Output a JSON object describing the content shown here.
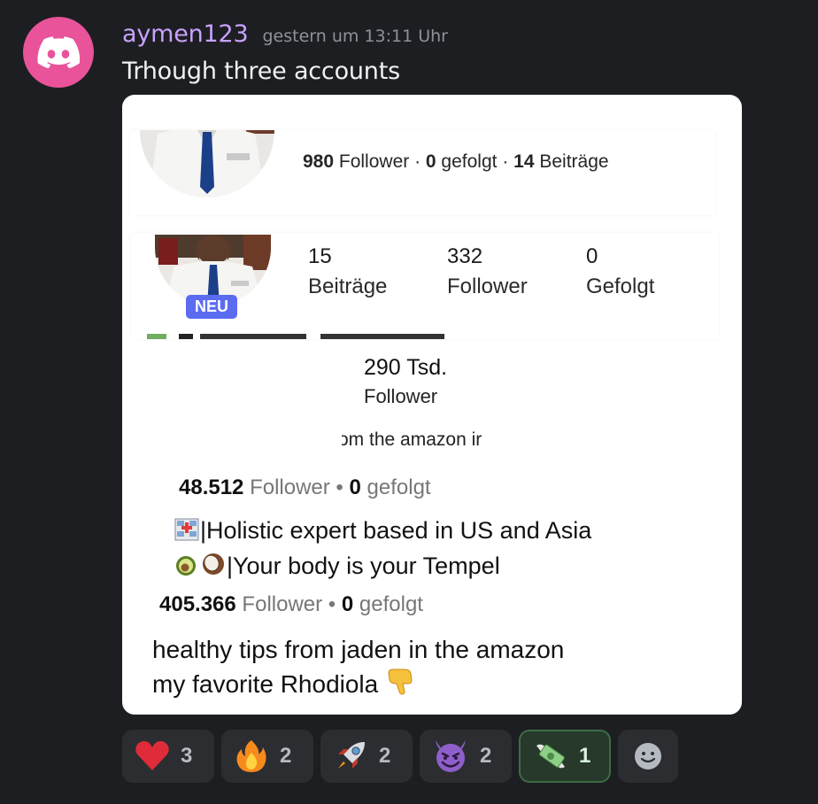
{
  "message": {
    "username": "aymen123",
    "timestamp": "gestern um 13:11 Uhr",
    "text": "Trhough three accounts",
    "avatar_icon": "discord-logo-icon"
  },
  "attachment": {
    "crop1": {
      "followers_num": "980",
      "followers_label": " Follower · ",
      "following_num": "0",
      "following_label": " gefolgt · ",
      "posts_num": "14",
      "posts_label": " Beiträge"
    },
    "crop2": {
      "badge": "NEU",
      "posts_num": "15",
      "posts_label": "Beiträge",
      "followers_num": "332",
      "followers_label": "Follower",
      "following_num": "0",
      "following_label": "Gefolgt"
    },
    "crop3": {
      "followers_num": "290 Tsd.",
      "followers_label": "Follower",
      "partial_text": "om the amazon ir"
    },
    "crop4": {
      "followers_num": "48.512",
      "followers_label": " Follower  •  ",
      "following_num": "0",
      "following_label": " gefolgt",
      "bio_line1": "|Holistic expert based in US and Asia",
      "bio_line2": "|Your body is your Tempel"
    },
    "crop5": {
      "followers_num": "405.366",
      "followers_label": " Follower  •  ",
      "following_num": "0",
      "following_label": " gefolgt",
      "bio_line1": "healthy tips from jaden in the amazon",
      "bio_line2": "my favorite Rhodiola"
    }
  },
  "reactions": [
    {
      "icon": "heart-icon",
      "count": "3",
      "active": false
    },
    {
      "icon": "fire-icon",
      "count": "2",
      "active": false
    },
    {
      "icon": "rocket-icon",
      "count": "2",
      "active": false
    },
    {
      "icon": "smiling-devil-icon",
      "count": "2",
      "active": false
    },
    {
      "icon": "money-with-wings-icon",
      "count": "1",
      "active": true
    },
    {
      "icon": "add-reaction-icon",
      "count": "",
      "active": false
    }
  ],
  "colors": {
    "background": "#1d1e22",
    "username": "#c8a2ff",
    "avatar": "#e8539a",
    "badge": "#5b6cf0",
    "active_reaction_border": "#3e6b45"
  }
}
